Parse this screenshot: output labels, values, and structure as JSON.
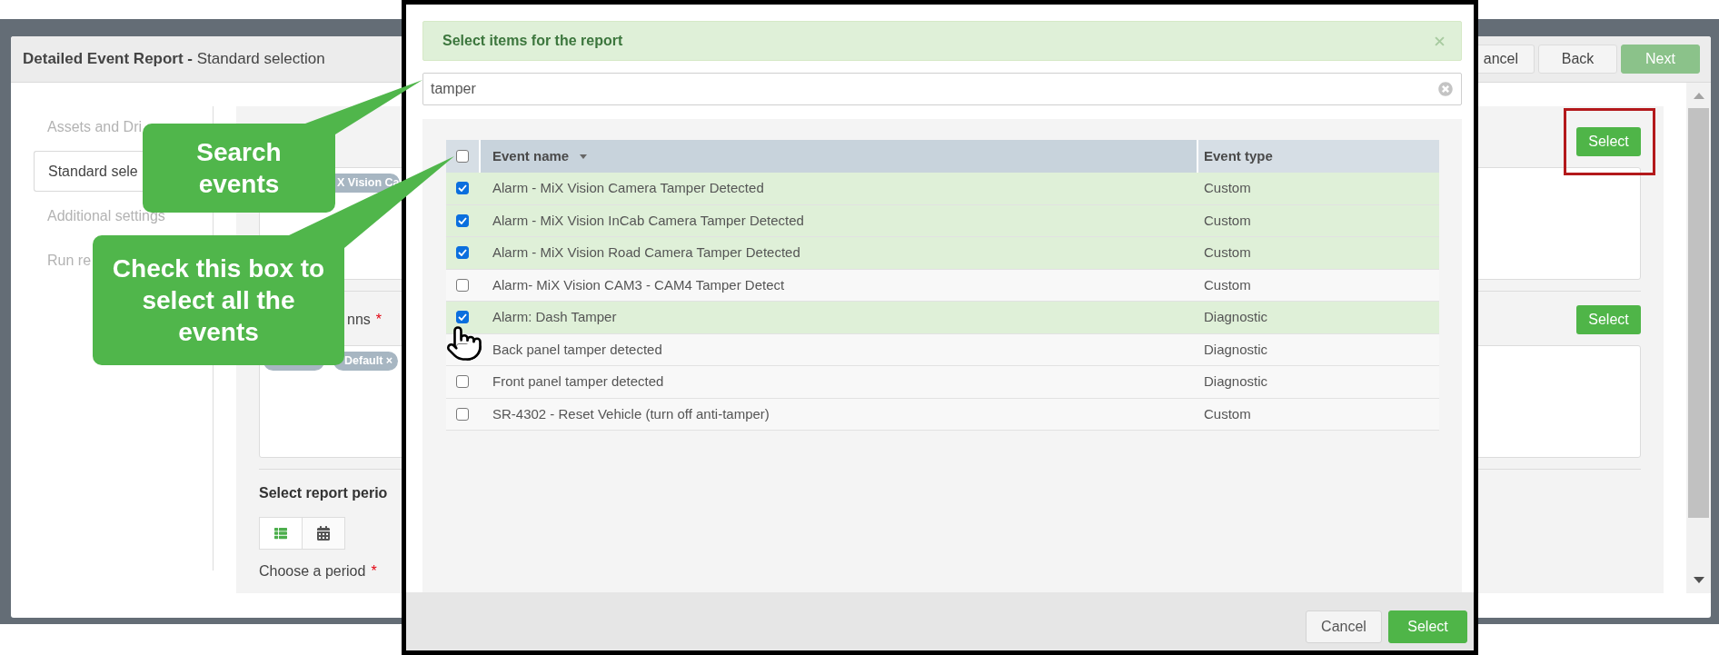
{
  "background_window": {
    "title": "**Detailed Event Report -** Standard selection",
    "header_buttons": [
      {
        "label": "ancel",
        "kind": "default",
        "disabled": false
      },
      {
        "label": "Back",
        "kind": "default",
        "disabled": false
      },
      {
        "label": "Next",
        "kind": "primary",
        "disabled": true
      }
    ],
    "steps": [
      {
        "label": "Assets and Dri",
        "selected": false
      },
      {
        "label": "Standard sele",
        "selected": true
      },
      {
        "label": "Additional settings",
        "selected": false
      },
      {
        "label": "Run re",
        "selected": false
      }
    ],
    "sections": [
      {
        "select_button": "Select",
        "highlighted": true,
        "tags": [
          {
            "label": "X Vision Ca"
          }
        ]
      },
      {
        "label": "nns",
        "required_mark": "*",
        "select_button": "Select",
        "tags": [
          {
            "label": "Default ×"
          }
        ]
      }
    ],
    "period": {
      "heading": "Select report perio",
      "views": [
        {
          "kind": "list",
          "selected": true
        },
        {
          "kind": "calendar",
          "selected": false
        }
      ],
      "label": "Choose a period",
      "required_mark": "*"
    }
  },
  "dialog": {
    "title": "Select items for the report",
    "search": {
      "value": "tamper"
    },
    "table": {
      "all_checked": false,
      "columns": [
        {
          "label": "Event name",
          "sorted": true
        },
        {
          "label": "Event type",
          "sorted": false
        }
      ],
      "rows": [
        {
          "name": "Alarm - MiX Vision Camera Tamper Detected",
          "type": "Custom",
          "checked": true
        },
        {
          "name": "Alarm - MiX Vision InCab Camera Tamper Detected",
          "type": "Custom",
          "checked": true
        },
        {
          "name": "Alarm - MiX Vision Road Camera Tamper Detected",
          "type": "Custom",
          "checked": true
        },
        {
          "name": "Alarm- MiX Vision CAM3 - CAM4 Tamper Detect",
          "type": "Custom",
          "checked": false
        },
        {
          "name": "Alarm: Dash Tamper",
          "type": "Diagnostic",
          "checked": true
        },
        {
          "name": "Back panel tamper detected",
          "type": "Diagnostic",
          "checked": false
        },
        {
          "name": "Front panel tamper detected",
          "type": "Diagnostic",
          "checked": false
        },
        {
          "name": "SR-4302 - Reset Vehicle (turn off anti-tamper)",
          "type": "Custom",
          "checked": false
        }
      ]
    },
    "buttons": [
      {
        "label": "Cancel",
        "kind": "default"
      },
      {
        "label": "Select",
        "kind": "primary"
      }
    ]
  },
  "callouts": [
    {
      "text": "Search events"
    },
    {
      "text": "Check this box to select all the events"
    }
  ]
}
